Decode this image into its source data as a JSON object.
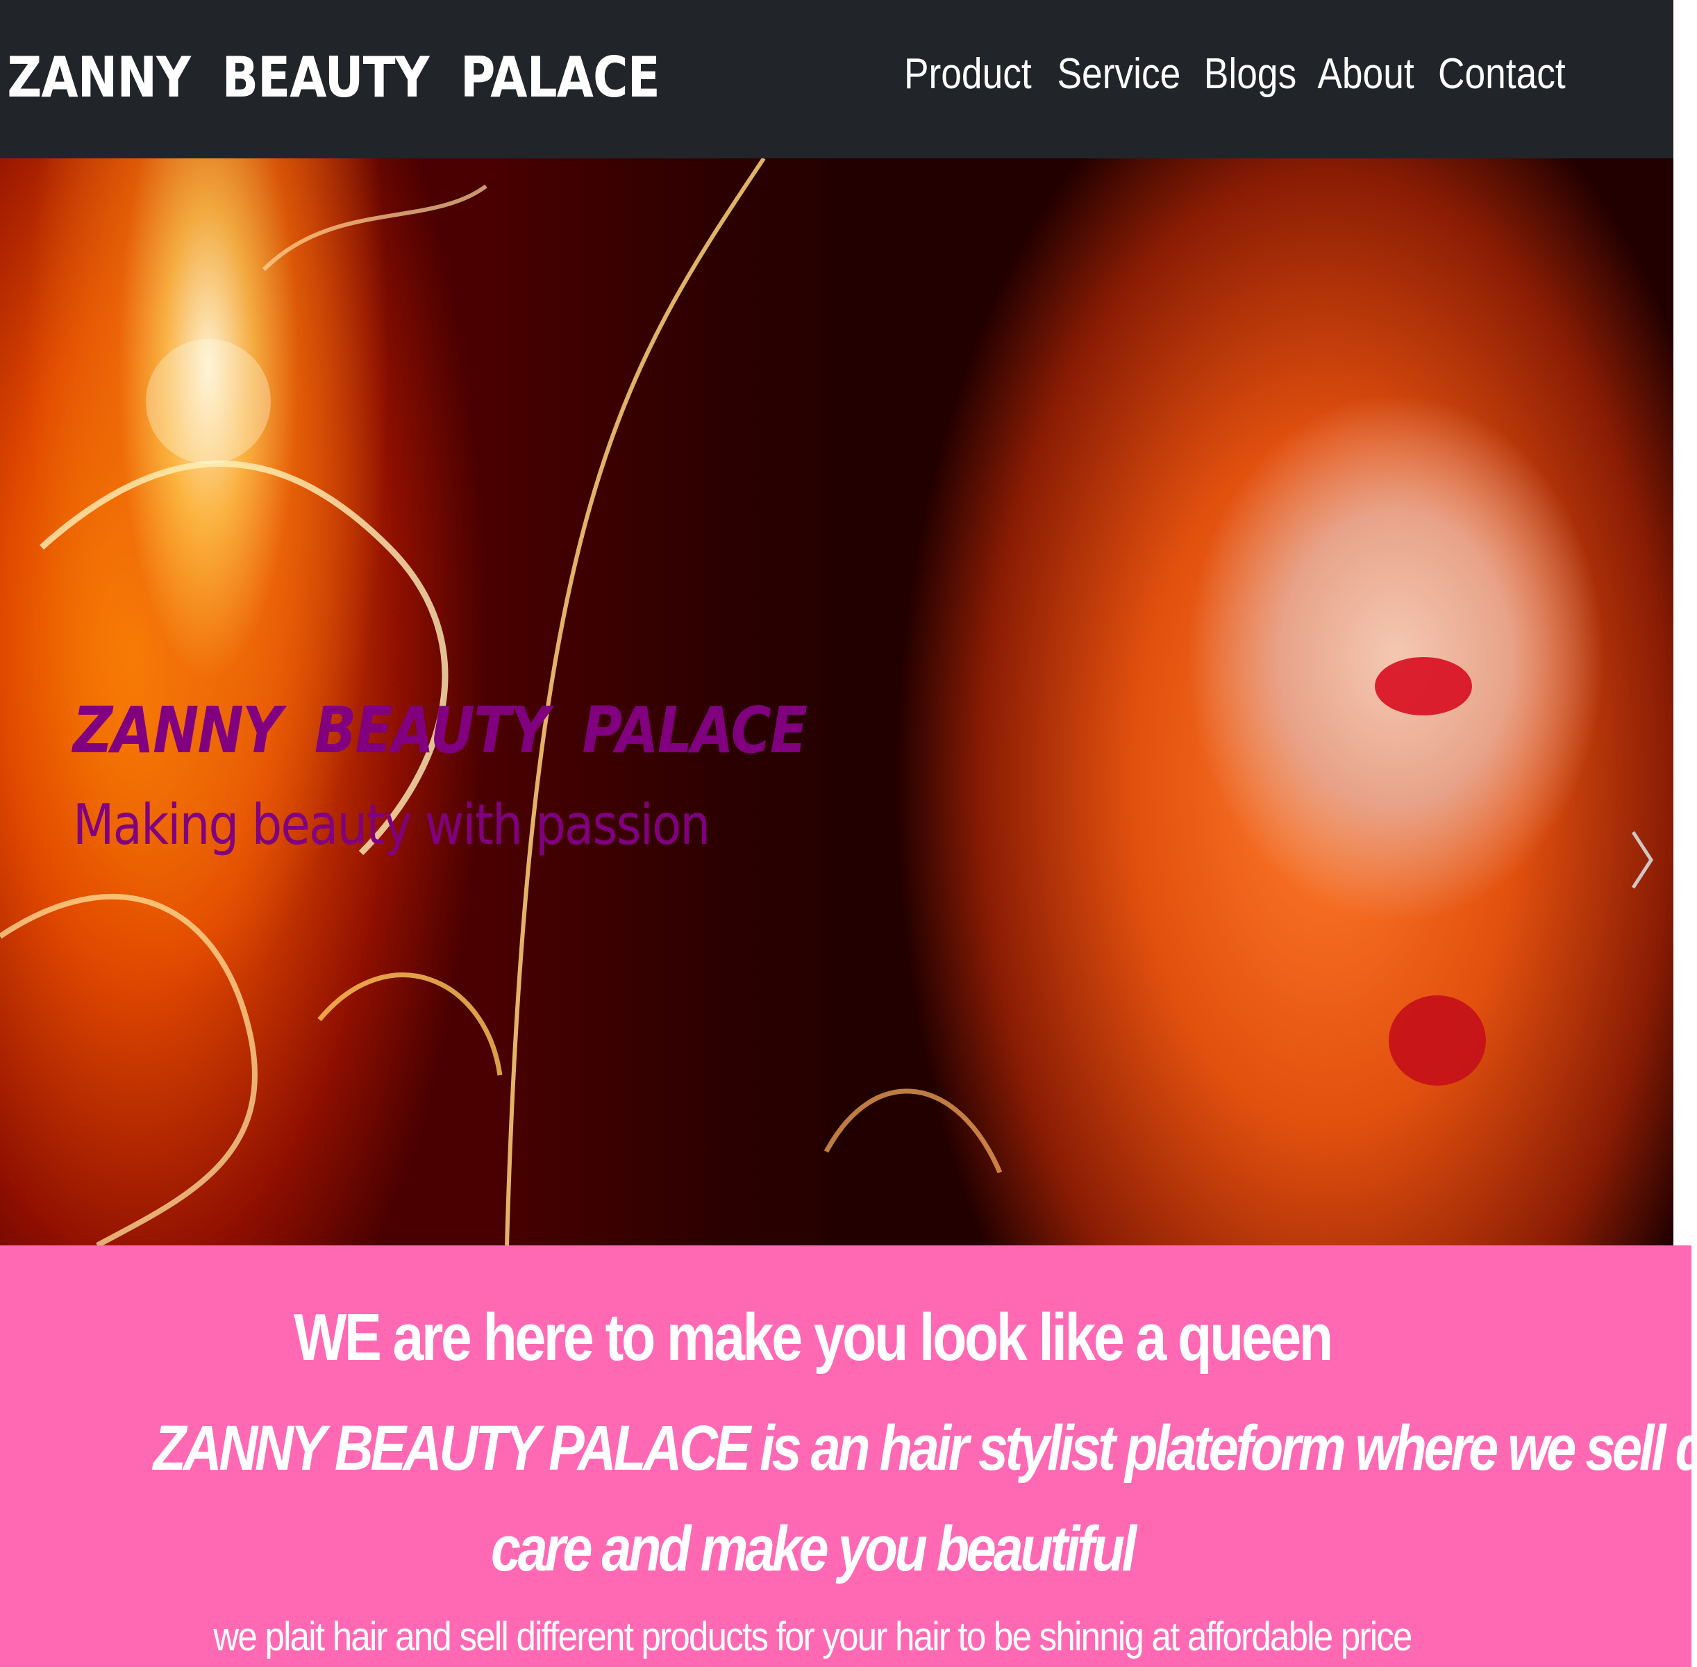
{
  "navbar": {
    "brand": "ZANNY  BEAUTY  PALACE",
    "links": [
      "Product",
      "Service",
      "Blogs",
      "About",
      "Contact"
    ]
  },
  "hero": {
    "title": "ZANNY  BEAUTY  PALACE",
    "subtitle": "Making beauty with passion",
    "next_icon": "chevron-right-icon"
  },
  "about": {
    "heading": "WE are here to make you look like a queen",
    "description_line1": "ZANNY BEAUTY PALACE is an hair stylist plateform where we sell different type of hair",
    "description_line2": "care and make you beautiful",
    "note": "we plait hair and sell different products for your hair to be shinnig at affordable price"
  },
  "colors": {
    "navbar_bg": "#212529",
    "hero_text": "#800080",
    "about_bg": "#ff69b4",
    "about_text": "#ffffff"
  }
}
